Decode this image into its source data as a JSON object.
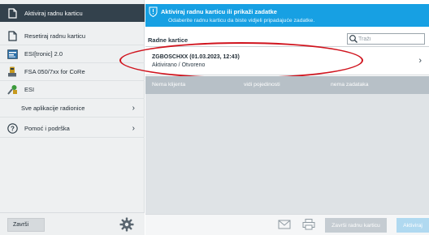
{
  "sidebar": {
    "items": [
      {
        "label": "Aktiviraj radnu karticu",
        "icon": "document-icon",
        "active": true
      },
      {
        "label": "Resetiraj radnu karticu",
        "icon": "document-icon",
        "active": false
      },
      {
        "label": "ESI[tronic] 2.0",
        "icon": "esitronic-icon",
        "active": false
      },
      {
        "label": "FSA 050/7xx for CoRe",
        "icon": "fsa-device-icon",
        "active": false
      },
      {
        "label": "ESI",
        "icon": "esi-tool-icon",
        "active": false
      },
      {
        "label": "Sve aplikacije radionice",
        "icon": "",
        "active": false
      },
      {
        "label": "Pomoć i podrška",
        "icon": "help-icon",
        "active": false
      }
    ],
    "footer": {
      "finish_label": "Završi",
      "settings_icon": "gear-icon"
    }
  },
  "banner": {
    "title": "Aktiviraj radnu karticu ili prikaži zadatke",
    "subtitle": "Odaberite radnu karticu da biste vidjeli pripadajuće zadatke.",
    "icon": "info-shield-icon",
    "color": "#17a0e3"
  },
  "list": {
    "title": "Radne kartice",
    "search_placeholder": "Traži",
    "search_value": "",
    "rows": [
      {
        "name": "ZGBOSCHXX (01.03.2023, 12:43)",
        "status": "Aktivirano / Otvoreno"
      }
    ],
    "detail_columns": [
      "Nema klijenta",
      "vidi pojedinosti",
      "nema zadataka"
    ]
  },
  "toolbar": {
    "mail_icon": "mail-icon",
    "print_icon": "printer-icon",
    "finish_card_label": "Završi radnu karticu",
    "activate_label": "Aktiviraj"
  },
  "colors": {
    "sidebar_active": "#33414c",
    "accent": "#17a0e3",
    "highlight": "#d0141e"
  }
}
